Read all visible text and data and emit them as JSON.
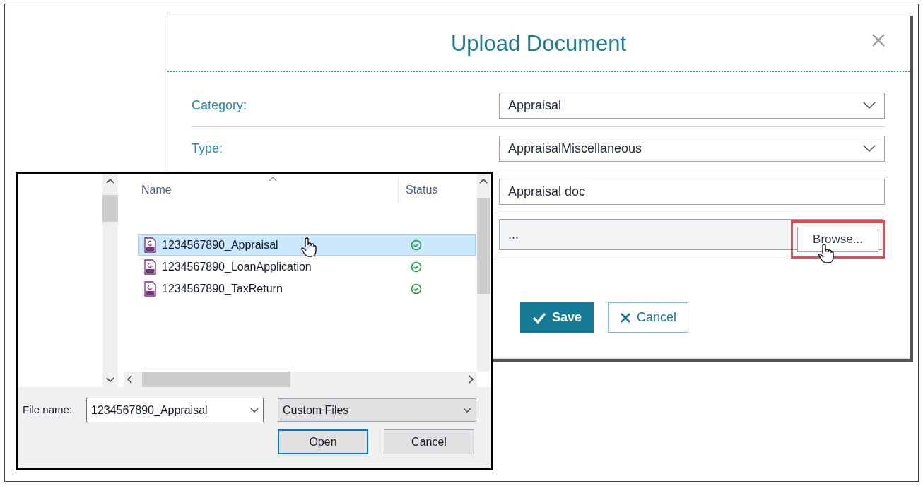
{
  "upload_dialog": {
    "title": "Upload Document",
    "fields": [
      {
        "kind": "select",
        "label": "Category:",
        "value": "Appraisal"
      },
      {
        "kind": "select",
        "label": "Type:",
        "value": "AppraisalMiscellaneous"
      },
      {
        "kind": "text",
        "value": "Appraisal doc"
      },
      {
        "kind": "file",
        "value": "...",
        "button": "Browse..."
      }
    ],
    "buttons": [
      {
        "kind": "primary",
        "label": "Save"
      },
      {
        "kind": "secondary",
        "label": "Cancel"
      }
    ]
  },
  "file_dialog": {
    "columns": [
      "Name",
      "Status"
    ],
    "files": [
      {
        "name": "1234567890_Appraisal",
        "selected": true
      },
      {
        "name": "1234567890_LoanApplication",
        "selected": false
      },
      {
        "name": "1234567890_TaxReturn",
        "selected": false
      }
    ],
    "file_name_label": "File name:",
    "file_name": "1234567890_Appraisal",
    "file_type": "Custom Files",
    "buttons": [
      {
        "label": "Open",
        "default": true
      },
      {
        "label": "Cancel",
        "default": false
      }
    ]
  }
}
